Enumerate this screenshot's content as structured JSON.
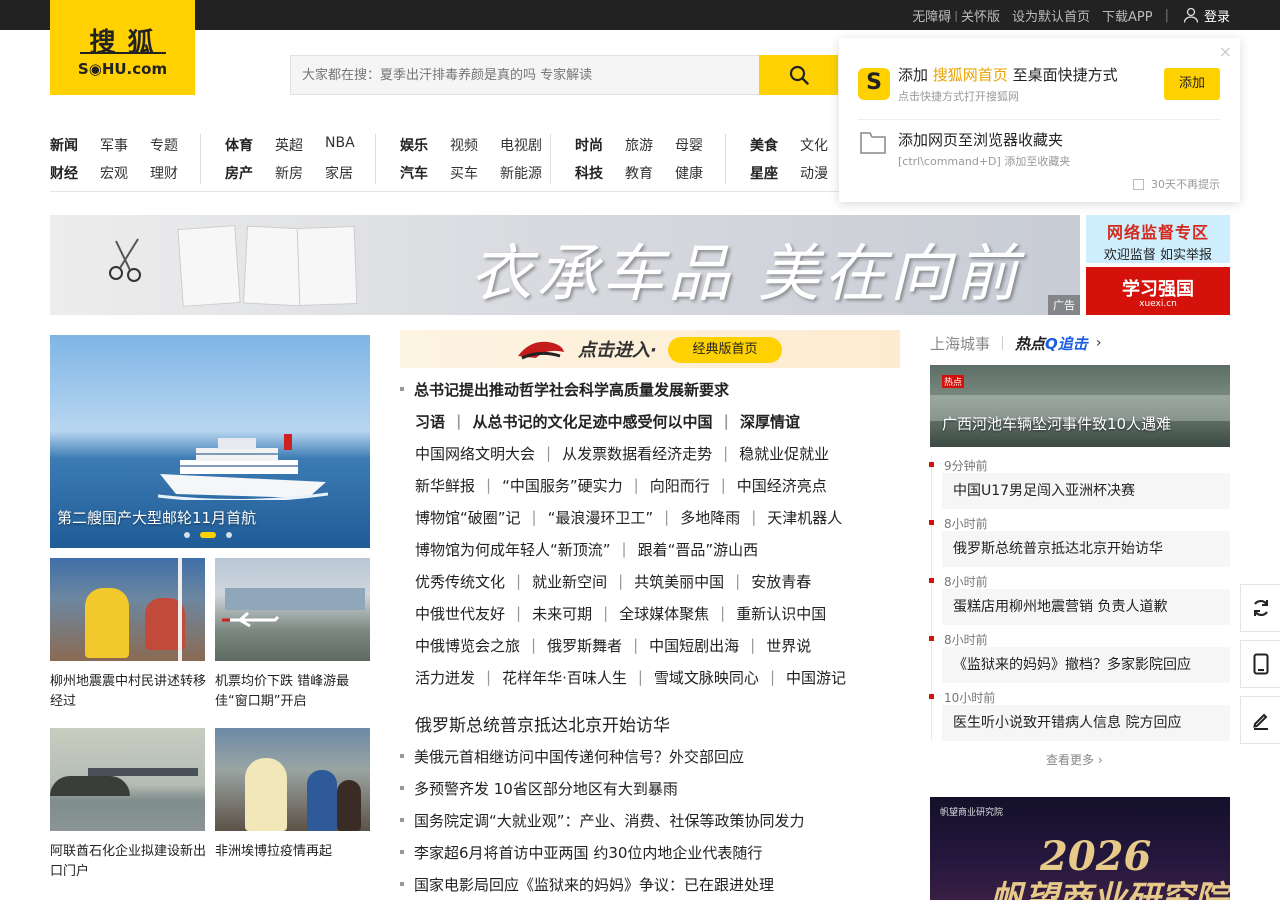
{
  "topbar": {
    "accessibility": "无障碍",
    "elderly": "关怀版",
    "set_home": "设为默认首页",
    "download_app": "下载APP",
    "separator": "|",
    "login": "登录"
  },
  "logo": {
    "cn": "搜狐",
    "en": "S◉HU.com"
  },
  "search": {
    "placeholder": "大家都在搜：夏季出汗排毒养颜是真的吗 专家解读"
  },
  "nav": {
    "groups": [
      {
        "row1": [
          "新闻",
          "军事",
          "专题"
        ],
        "row2": [
          "财经",
          "宏观",
          "理财"
        ]
      },
      {
        "row1": [
          "体育",
          "英超",
          "NBA"
        ],
        "row2": [
          "房产",
          "新房",
          "家居"
        ]
      },
      {
        "row1": [
          "娱乐",
          "视频",
          "电视剧"
        ],
        "row2": [
          "汽车",
          "买车",
          "新能源"
        ]
      },
      {
        "row1": [
          "时尚",
          "旅游",
          "母婴"
        ],
        "row2": [
          "科技",
          "教育",
          "健康"
        ]
      },
      {
        "row1": [
          "美食",
          "文化"
        ],
        "row2": [
          "星座",
          "动漫"
        ]
      }
    ]
  },
  "popup": {
    "add_prefix": "添加",
    "add_highlight": "搜狐网首页",
    "add_suffix": "至桌面快捷方式",
    "add_sub": "点击快捷方式打开搜狐网",
    "add_button": "添加",
    "fav_title": "添加网页至浏览器收藏夹",
    "fav_sub": "[ctrl\\command+D] 添加至收藏夹",
    "no_show": "30天不再提示",
    "close": "×"
  },
  "banner": {
    "slogan": "衣承车品 美在向前",
    "ad_label": "广告",
    "side1_line1": "网络监督专区",
    "side1_line2": "欢迎监督 如实举报",
    "side2_line1": "学习强国",
    "side2_line2": "xuexi.cn"
  },
  "left": {
    "hero_caption": "第二艘国产大型邮轮11月首航",
    "slide_count": 3,
    "active_slide": 2,
    "thumbs": [
      {
        "caption": "柳州地震震中村民讲述转移经过"
      },
      {
        "caption": "机票均价下跌 错峰游最佳“窗口期”开启"
      },
      {
        "caption": "阿联酋石化企业拟建设新出口门户"
      },
      {
        "caption": "非洲埃博拉疫情再起"
      }
    ]
  },
  "middle": {
    "classic_text": "点击进入·",
    "classic_button": "经典版首页",
    "headline": "总书记提出推动哲学社会科学高质量发展新要求",
    "rows": [
      {
        "bold": true,
        "items": [
          "习语",
          "从总书记的文化足迹中感受何以中国",
          "深厚情谊"
        ]
      },
      {
        "bold": false,
        "items": [
          "中国网络文明大会",
          "从发票数据看经济走势",
          "稳就业促就业"
        ]
      },
      {
        "bold": false,
        "items": [
          "新华鲜报",
          "“中国服务”硬实力",
          "向阳而行",
          "中国经济亮点"
        ]
      },
      {
        "bold": false,
        "items": [
          "博物馆“破圈”记",
          "“最浪漫环卫工”",
          "多地降雨",
          "天津机器人"
        ]
      },
      {
        "bold": false,
        "items": [
          "博物馆为何成年轻人“新顶流”",
          "跟着“晋品”游山西"
        ]
      },
      {
        "bold": false,
        "items": [
          "优秀传统文化",
          "就业新空间",
          "共筑美丽中国",
          "安放青春"
        ]
      },
      {
        "bold": false,
        "items": [
          "中俄世代友好",
          "未来可期",
          "全球媒体聚焦",
          "重新认识中国"
        ]
      },
      {
        "bold": false,
        "items": [
          "中俄博览会之旅",
          "俄罗斯舞者",
          "中国短剧出海",
          "世界说"
        ]
      },
      {
        "bold": false,
        "items": [
          "活力迸发",
          "花样年华·百味人生",
          "雪域文脉映同心",
          "中国游记"
        ]
      }
    ],
    "lead": "俄罗斯总统普京抵达北京开始访华",
    "list": [
      "美俄元首相继访问中国传递何种信号？外交部回应",
      "多预警齐发 10省区部分地区有大到暴雨",
      "国务院定调“大就业观”：产业、消费、社保等政策协同发力",
      "李家超6月将首访中亚两国 约30位内地企业代表随行",
      "国家电影局回应《监狱来的妈妈》争议：已在跟进处理"
    ]
  },
  "right": {
    "city": "上海城事",
    "hot_prefix": "热点",
    "hot_suffix": "追击",
    "hero_badge": "热点",
    "hero_caption": "广西河池车辆坠河事件致10人遇难",
    "timeline": [
      {
        "time": "9分钟前",
        "title": "中国U17男足闯入亚洲杯决赛"
      },
      {
        "time": "8小时前",
        "title": "俄罗斯总统普京抵达北京开始访华"
      },
      {
        "time": "8小时前",
        "title": "蛋糕店用柳州地震营销 负责人道歉"
      },
      {
        "time": "8小时前",
        "title": "《监狱来的妈妈》撤档？多家影院回应"
      },
      {
        "time": "10小时前",
        "title": "医生听小说致开错病人信息 院方回应"
      }
    ],
    "more": "查看更多",
    "ad_head": "帆望商业研究院",
    "ad_year": "2026",
    "ad_title": "帆望商业研究院"
  },
  "colors": {
    "brand_yellow": "#ffd100",
    "accent_red": "#d4120b",
    "topbar_bg": "#222222"
  }
}
